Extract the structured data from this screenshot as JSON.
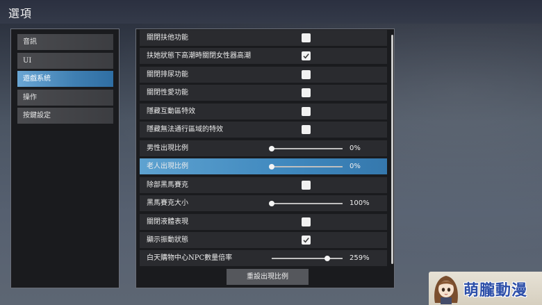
{
  "window": {
    "title": "選項"
  },
  "sidebar": {
    "items": [
      {
        "label": "音訊",
        "active": false
      },
      {
        "label": "UI",
        "active": false
      },
      {
        "label": "遊戲系統",
        "active": true
      },
      {
        "label": "操作",
        "active": false
      },
      {
        "label": "按鍵設定",
        "active": false
      }
    ]
  },
  "settings": {
    "rows": [
      {
        "label": "關閉扶他功能",
        "type": "checkbox",
        "checked": false
      },
      {
        "label": "扶她狀態下高潮時關閉女性器高潮",
        "type": "checkbox",
        "checked": true
      },
      {
        "label": "關閉排尿功能",
        "type": "checkbox",
        "checked": false
      },
      {
        "label": "關閉性愛功能",
        "type": "checkbox",
        "checked": false
      },
      {
        "label": "隱藏互動區特效",
        "type": "checkbox",
        "checked": false
      },
      {
        "label": "隱藏無法通行區域的特效",
        "type": "checkbox",
        "checked": false
      },
      {
        "label": "男性出現比例",
        "type": "slider",
        "value_text": "0%",
        "level": 0.0
      },
      {
        "label": "老人出現比例",
        "type": "slider",
        "value_text": "0%",
        "level": 0.0,
        "highlight": true
      },
      {
        "label": "除部黑馬賽克",
        "type": "checkbox",
        "checked": false
      },
      {
        "label": "黑馬賽克大小",
        "type": "slider",
        "value_text": "100%",
        "level": 0.0
      },
      {
        "label": "關閉液體表現",
        "type": "checkbox",
        "checked": false
      },
      {
        "label": "顯示振動狀態",
        "type": "checkbox",
        "checked": true
      },
      {
        "label": "白天購物中心NPC數量倍率",
        "type": "slider",
        "value_text": "259%",
        "level": 0.79
      }
    ]
  },
  "actions": {
    "reset_label": "重設出現比例"
  },
  "watermark": {
    "text": "萌朧動漫"
  }
}
